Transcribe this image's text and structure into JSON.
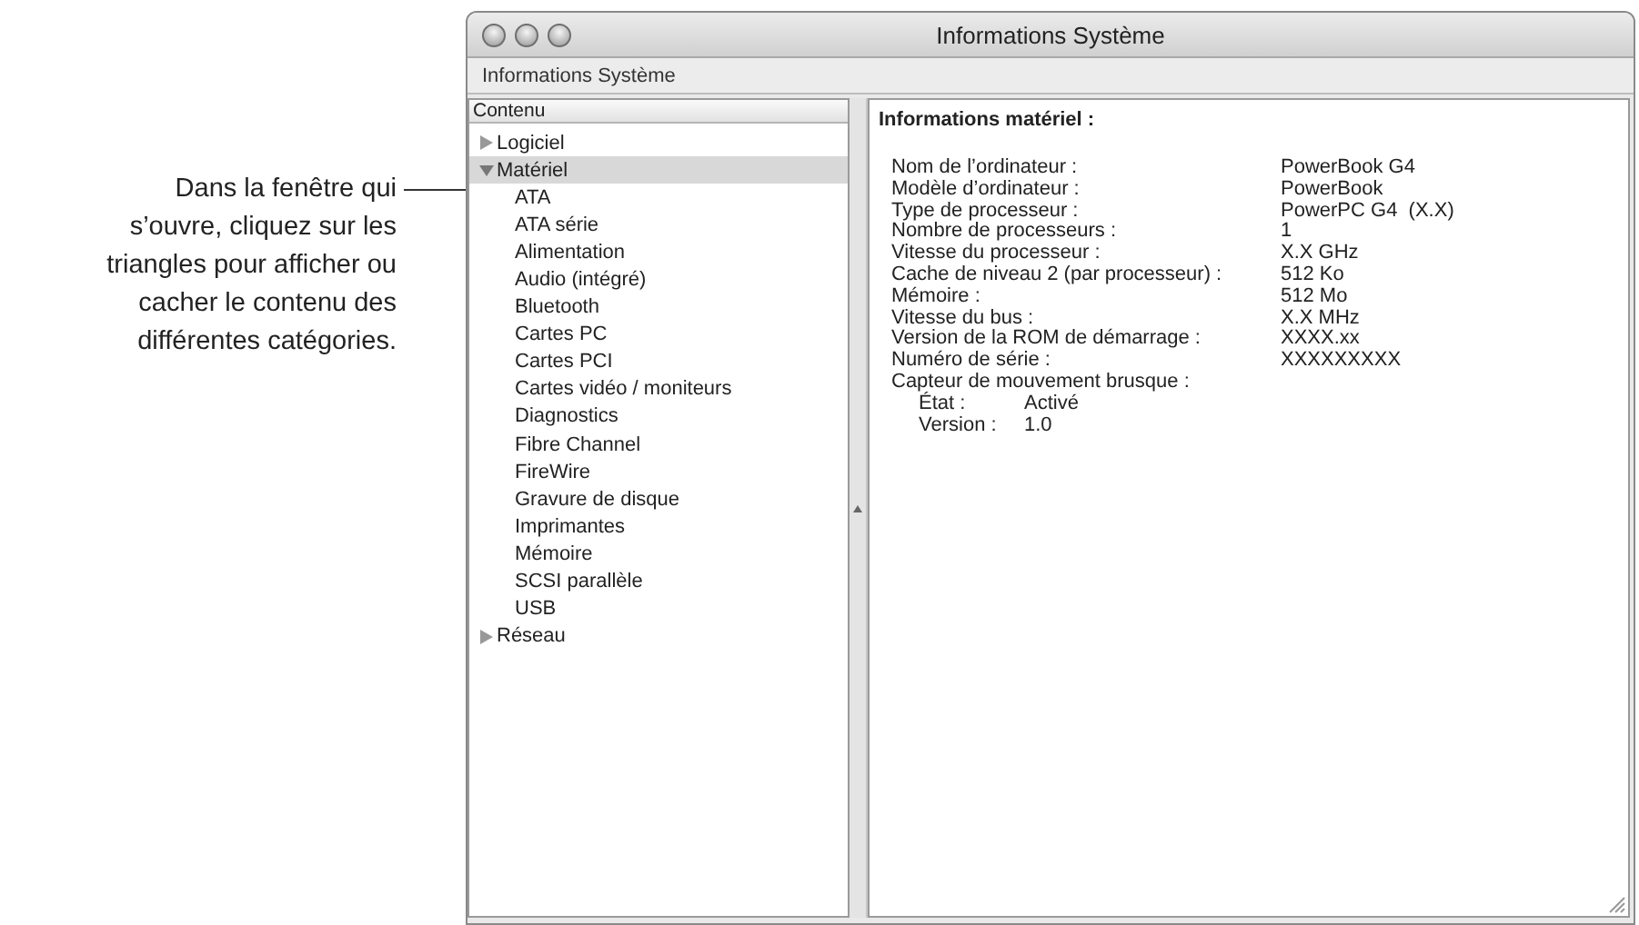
{
  "callout": {
    "lines": [
      "Dans la fenêtre qui",
      "s’ouvre, cliquez sur les",
      "triangles pour afficher ou",
      "cacher le contenu des",
      "différentes catégories."
    ]
  },
  "window": {
    "title": "Informations Système",
    "toolbar_label": "Informations Système"
  },
  "sidebar": {
    "header": "Contenu",
    "items": [
      {
        "label": "Logiciel",
        "expanded": false,
        "selected": false
      },
      {
        "label": "Matériel",
        "expanded": true,
        "selected": true,
        "children": [
          {
            "label": "ATA",
            "selected": false
          },
          {
            "label": "ATA série",
            "selected": false
          },
          {
            "label": "Alimentation",
            "selected": false
          },
          {
            "label": "Audio (intégré)",
            "selected": false
          },
          {
            "label": "Bluetooth",
            "selected": false
          },
          {
            "label": "Cartes PC",
            "selected": false
          },
          {
            "label": "Cartes PCI",
            "selected": false
          },
          {
            "label": "Cartes vidéo / moniteurs",
            "selected": false
          },
          {
            "label": "Diagnostics",
            "selected": false
          },
          {
            "label": "Fibre Channel",
            "selected": false
          },
          {
            "label": "FireWire",
            "selected": false
          },
          {
            "label": "Gravure de disque",
            "selected": false
          },
          {
            "label": "Imprimantes",
            "selected": false
          },
          {
            "label": "Mémoire",
            "selected": false
          },
          {
            "label": "SCSI parallèle",
            "selected": false
          },
          {
            "label": "USB",
            "selected": false
          }
        ]
      },
      {
        "label": "Réseau",
        "expanded": false,
        "selected": false
      }
    ]
  },
  "details": {
    "heading": "Informations matériel :",
    "rows": [
      {
        "label": "Nom de l’ordinateur :",
        "value": "PowerBook G4"
      },
      {
        "label": "Modèle d’ordinateur :",
        "value": "PowerBook"
      },
      {
        "label": "Type de processeur :",
        "value": "PowerPC G4  (X.X)"
      },
      {
        "label": "Nombre de processeurs :",
        "value": "1"
      },
      {
        "label": "Vitesse du processeur :",
        "value": "X.X GHz"
      },
      {
        "label": "Cache de niveau 2 (par processeur) :",
        "value": "512 Ko"
      },
      {
        "label": "Mémoire :",
        "value": "512 Mo"
      },
      {
        "label": "Vitesse du bus :",
        "value": "X.X MHz"
      },
      {
        "label": "Version de la ROM de démarrage :",
        "value": "XXXX.xx"
      },
      {
        "label": "Numéro de série :",
        "value": "XXXXXXXXX"
      },
      {
        "label": "Capteur de mouvement brusque :",
        "children": [
          {
            "label": "État :",
            "value": "Activé"
          },
          {
            "label": "Version :",
            "value": "1.0"
          }
        ]
      }
    ]
  }
}
